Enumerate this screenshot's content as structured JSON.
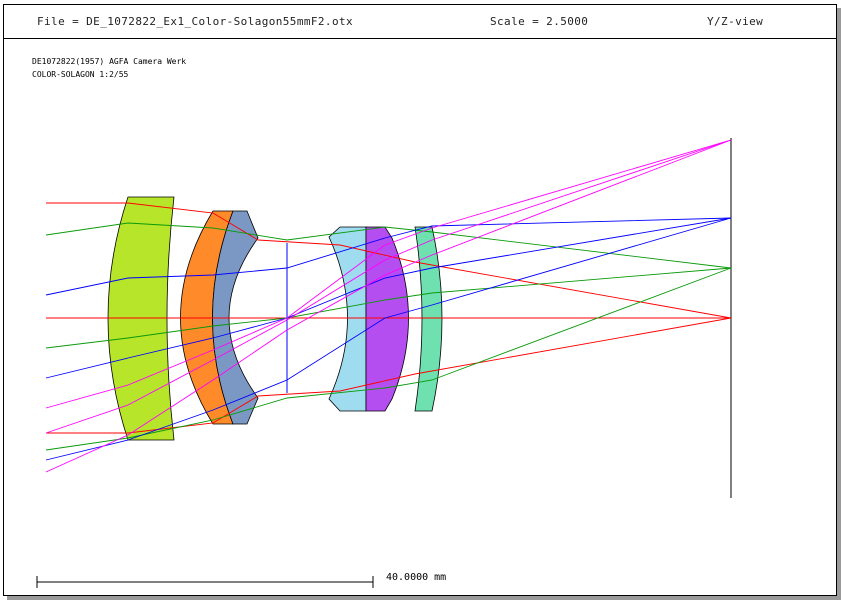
{
  "header": {
    "file_text": "File = DE_1072822_Ex1_Color-Solagon55mmF2.otx",
    "scale_text": "Scale = 2.5000",
    "view_text": "Y/Z-view"
  },
  "notes": {
    "line1": "DE1072822(1957) AGFA Camera Werk",
    "line2": "COLOR-SOLAGON 1:2/55"
  },
  "scale_bar": {
    "label": "40.0000 mm"
  },
  "colors": {
    "lens1": "#b7e52a",
    "lens2": "#ff8a2a",
    "lens3": "#7b98c4",
    "lens4": "#9fdcf0",
    "lens5": "#b54ef0",
    "lens6": "#6fe0b0",
    "ray_axial": "#ff0000",
    "ray_field1": "#0a9a0a",
    "ray_field2": "#0000ff",
    "ray_field3": "#ff00ff"
  }
}
